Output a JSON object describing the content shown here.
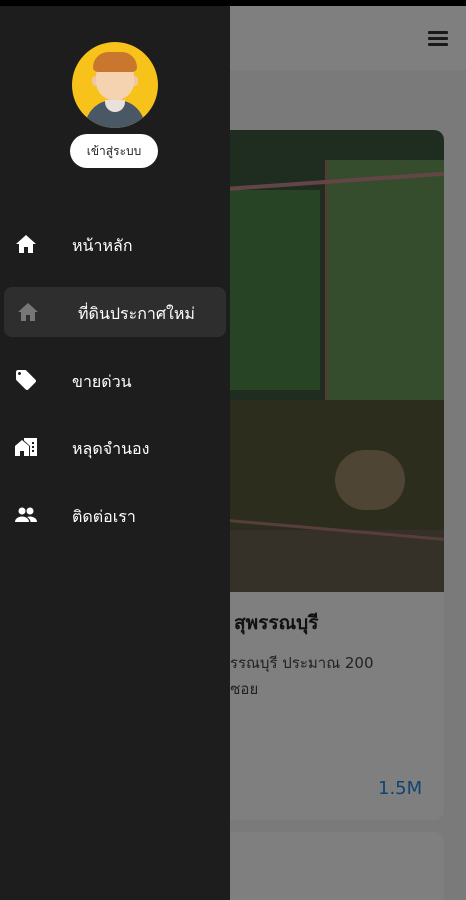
{
  "header": {
    "menu_icon": "hamburger-menu-icon"
  },
  "listing": {
    "title": "สุพรรณบุรี",
    "description_line1": "พรรณบุรี ประมาณ 200",
    "description_line2": "นซอย",
    "meta": "}",
    "price": "1.5M"
  },
  "drawer": {
    "avatar_icon": "user-avatar-icon",
    "login_label": "เข้าสู่ระบบ",
    "items": [
      {
        "label": "หน้าหลัก",
        "icon": "home-icon",
        "active": false
      },
      {
        "label": "ที่ดินประกาศใหม่",
        "icon": "home-icon",
        "active": true
      },
      {
        "label": "ขายด่วน",
        "icon": "tag-icon",
        "active": false
      },
      {
        "label": "หลุดจำนอง",
        "icon": "house-building-icon",
        "active": false
      },
      {
        "label": "ติดต่อเรา",
        "icon": "people-icon",
        "active": false
      }
    ]
  },
  "colors": {
    "drawer_bg": "#1d1d1d",
    "avatar_bg": "#f7c31a",
    "price": "#1e88e5"
  }
}
